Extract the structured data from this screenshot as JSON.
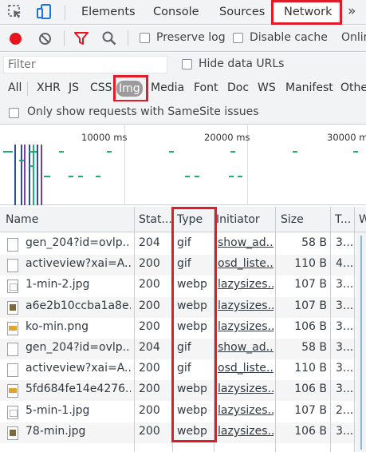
{
  "tabs": {
    "elements": "Elements",
    "console": "Console",
    "sources": "Sources",
    "network": "Network",
    "more": "»"
  },
  "toolbar": {
    "preserve_log": "Preserve log",
    "disable_cache": "Disable cache",
    "online": "Onlin"
  },
  "filter": {
    "placeholder": "Filter",
    "hide_data_urls": "Hide data URLs"
  },
  "type_filters": [
    "All",
    "XHR",
    "JS",
    "CSS",
    "Img",
    "Media",
    "Font",
    "Doc",
    "WS",
    "Manifest",
    "Othe"
  ],
  "active_type_filter": "Img",
  "samesite_label": "Only show requests with SameSite issues",
  "overview": {
    "ticks": [
      "10000 ms",
      "20000 ms",
      "30000 ms"
    ]
  },
  "table": {
    "headers": {
      "name": "Name",
      "status": "Stat...",
      "type": "Type",
      "initiator": "Initiator",
      "size": "Size",
      "time": "T...",
      "waterfall": "W"
    },
    "rows": [
      {
        "icon": "blank-file-icon",
        "name": "gen_204?id=ovlp...",
        "status": "204",
        "type": "gif",
        "initiator": "show_ad...",
        "size": "58 B",
        "time": "3..."
      },
      {
        "icon": "blank-file-icon",
        "name": "activeview?xai=A...",
        "status": "200",
        "type": "gif",
        "initiator": "osd_liste...",
        "size": "110 B",
        "time": "4..."
      },
      {
        "icon": "image-thumbnail-icon",
        "name": "1-min-2.jpg",
        "status": "200",
        "type": "webp",
        "initiator": "lazysizes...",
        "size": "107 B",
        "time": "3..."
      },
      {
        "icon": "image-thumbnail-icon",
        "name": "a6e2b10ccba1a8e...",
        "status": "200",
        "type": "webp",
        "initiator": "lazysizes...",
        "size": "107 B",
        "time": "3..."
      },
      {
        "icon": "image-thumbnail-icon",
        "name": "ko-min.png",
        "status": "200",
        "type": "webp",
        "initiator": "lazysizes...",
        "size": "106 B",
        "time": "3..."
      },
      {
        "icon": "blank-file-icon",
        "name": "gen_204?id=ovlp...",
        "status": "204",
        "type": "gif",
        "initiator": "show_ad...",
        "size": "58 B",
        "time": "3..."
      },
      {
        "icon": "blank-file-icon",
        "name": "activeview?xai=A...",
        "status": "200",
        "type": "gif",
        "initiator": "osd_liste...",
        "size": "110 B",
        "time": "3..."
      },
      {
        "icon": "image-thumbnail-icon",
        "name": "5fd684fe14e4276...",
        "status": "200",
        "type": "webp",
        "initiator": "lazysizes...",
        "size": "106 B",
        "time": "3..."
      },
      {
        "icon": "image-thumbnail-icon",
        "name": "5-min-1.jpg",
        "status": "200",
        "type": "webp",
        "initiator": "lazysizes...",
        "size": "107 B",
        "time": "2..."
      },
      {
        "icon": "image-thumbnail-icon",
        "name": "78-min.jpg",
        "status": "200",
        "type": "webp",
        "initiator": "lazysizes...",
        "size": "106 B",
        "time": "3..."
      }
    ]
  },
  "colors": {
    "highlight_box": "#e21b2a",
    "record_button": "#e8141e",
    "filter_icon": "#e8141e",
    "waterfall_dash": "#1db06b",
    "active_filter_bg": "#9b9b9b"
  }
}
